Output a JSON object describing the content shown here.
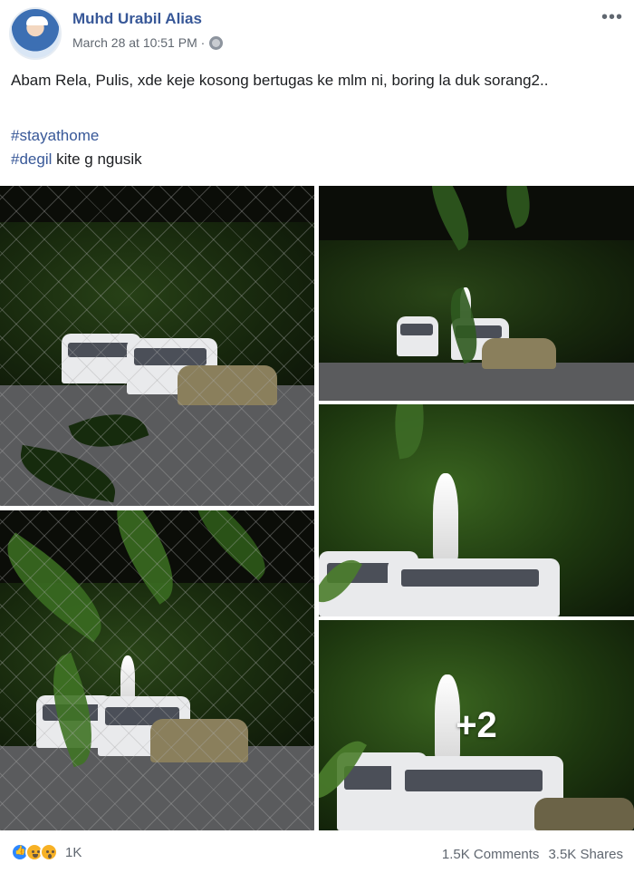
{
  "post": {
    "author": "Muhd Urabil Alias",
    "timestamp": "March 28 at 10:51 PM ·",
    "privacy_icon": "globe-icon",
    "text": "Abam Rela, Pulis, xde keje kosong bertugas ke mlm ni, boring la duk sorang2..",
    "hashtags": [
      {
        "tag": "#stayathome",
        "rest": ""
      },
      {
        "tag": "#degil",
        "rest": " kite g ngusik"
      }
    ]
  },
  "photos": {
    "more_count_label": "+2"
  },
  "footer": {
    "reaction_icons": [
      "like-icon",
      "haha-icon",
      "wow-icon"
    ],
    "reaction_count": "1K",
    "comments": "1.5K Comments",
    "shares": "3.5K Shares"
  },
  "colors": {
    "link_blue": "#385898",
    "meta_gray": "#606770",
    "like_blue": "#2d88ff",
    "emoji_yellow": "#f7b125"
  }
}
